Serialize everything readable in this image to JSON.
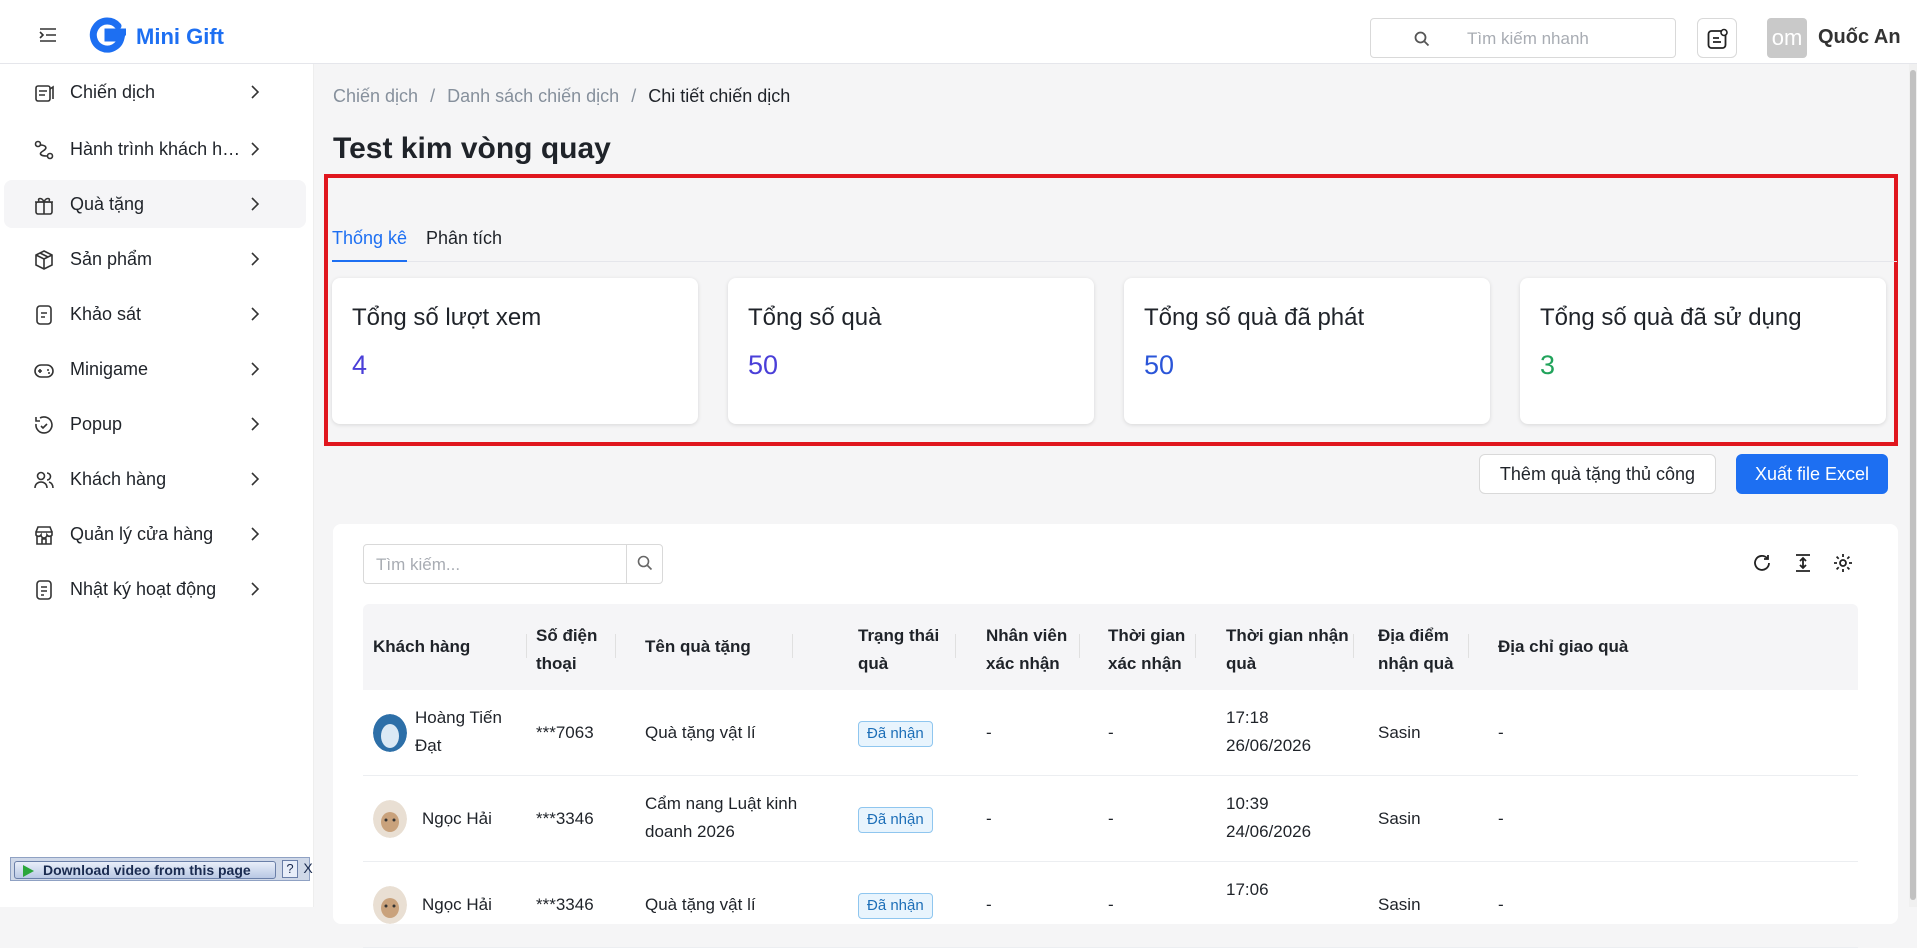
{
  "header": {
    "brand": "Mini Gift",
    "search_placeholder": "Tìm kiếm nhanh",
    "avatar_text": "om",
    "user_name": "Quốc An"
  },
  "sidebar": {
    "items": [
      {
        "label": "Chiến dịch",
        "icon": "campaign-icon"
      },
      {
        "label": "Hành trình khách hàng",
        "icon": "journey-icon"
      },
      {
        "label": "Quà tặng",
        "icon": "gift-icon"
      },
      {
        "label": "Sản phẩm",
        "icon": "product-box-icon"
      },
      {
        "label": "Khảo sát",
        "icon": "survey-icon"
      },
      {
        "label": "Minigame",
        "icon": "gamepad-icon"
      },
      {
        "label": "Popup",
        "icon": "popup-icon"
      },
      {
        "label": "Khách hàng",
        "icon": "customers-icon"
      },
      {
        "label": "Quản lý cửa hàng",
        "icon": "store-icon"
      },
      {
        "label": "Nhật ký hoạt động",
        "icon": "activity-log-icon"
      }
    ],
    "download_bar": {
      "label": "Download video from this page",
      "help": "?",
      "close": "X"
    }
  },
  "breadcrumb": [
    "Chiến dịch",
    "Danh sách chiến dịch",
    "Chi tiết chiến dịch"
  ],
  "breadcrumb_sep": "/",
  "page_title": "Test kim vòng quay",
  "tabs": [
    "Thống kê",
    "Phân tích"
  ],
  "stats": [
    {
      "label": "Tổng số lượt xem",
      "value": "4",
      "color": "#4a3fd8"
    },
    {
      "label": "Tổng số quà",
      "value": "50",
      "color": "#4a3fd8"
    },
    {
      "label": "Tổng số quà đã phát",
      "value": "50",
      "color": "#2a55d8"
    },
    {
      "label": "Tổng số quà đã sử dụng",
      "value": "3",
      "color": "#21a35b"
    }
  ],
  "actions": {
    "add_manual": "Thêm quà tặng thủ công",
    "export": "Xuất file Excel"
  },
  "table": {
    "search_placeholder": "Tìm kiếm...",
    "headers": [
      "Khách hàng",
      "Số điện thoại",
      "Tên quà tặng",
      "Trạng thái quà",
      "Nhân viên xác nhận",
      "Thời gian xác nhận",
      "Thời gian nhận quà",
      "Địa điểm nhận quà",
      "Địa chỉ giao quà"
    ],
    "rows": [
      {
        "customer": "Hoàng Tiến Đạt",
        "phone": "***7063",
        "gift": "Quà tặng vật lí",
        "status": "Đã nhận",
        "staff": "-",
        "confirm_time": "-",
        "receive_time": "17:18 26/06/2026",
        "place": "Sasin",
        "address": "-"
      },
      {
        "customer": "Ngọc Hải",
        "phone": "***3346",
        "gift": "Cẩm nang Luật kinh doanh 2026",
        "status": "Đã nhận",
        "staff": "-",
        "confirm_time": "-",
        "receive_time": "10:39 24/06/2026",
        "place": "Sasin",
        "address": "-"
      },
      {
        "customer": "Ngọc Hải",
        "phone": "***3346",
        "gift": "Quà tặng vật lí",
        "status": "Đã nhận",
        "staff": "-",
        "confirm_time": "-",
        "receive_time": "17:06",
        "place": "Sasin",
        "address": "-"
      }
    ]
  },
  "colors": {
    "primary": "#1d6ff2",
    "highlight_border": "#e0161e"
  }
}
